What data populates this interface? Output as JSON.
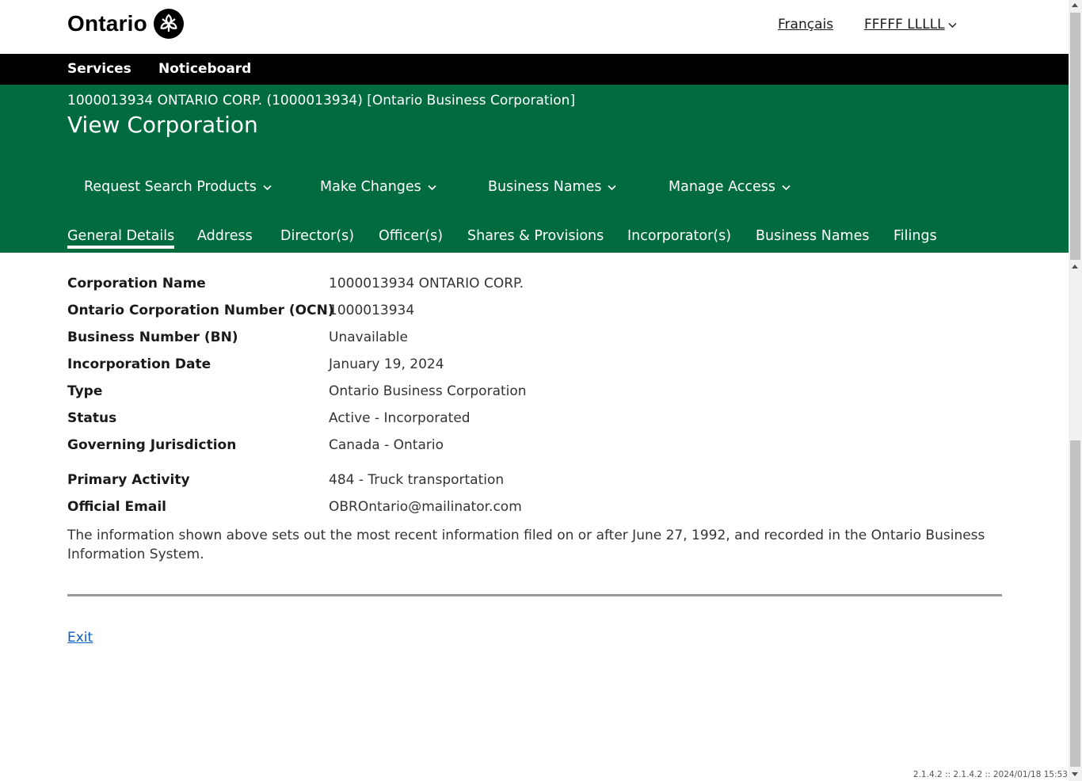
{
  "header": {
    "logo_text": "Ontario",
    "language_link": "Français",
    "user_name": "FFFFF LLLLL"
  },
  "nav": {
    "services": "Services",
    "noticeboard": "Noticeboard"
  },
  "corporation": {
    "heading": "1000013934 ONTARIO CORP. (1000013934) [Ontario Business Corporation]",
    "page_title": "View Corporation"
  },
  "actions": {
    "request_search_products": "Request Search Products",
    "make_changes": "Make Changes",
    "business_names": "Business Names",
    "manage_access": "Manage Access"
  },
  "tabs": {
    "general_details": "General Details",
    "address": "Address",
    "directors": "Director(s)",
    "officers": "Officer(s)",
    "shares": "Shares & Provisions",
    "incorporators": "Incorporator(s)",
    "business_names": "Business Names",
    "filings": "Filings"
  },
  "details": [
    {
      "label": "Corporation Name",
      "value": "1000013934 ONTARIO CORP."
    },
    {
      "label": "Ontario Corporation Number (OCN)",
      "value": "1000013934"
    },
    {
      "label": "Business Number (BN)",
      "value": "Unavailable"
    },
    {
      "label": "Incorporation Date",
      "value": "January 19, 2024"
    },
    {
      "label": "Type",
      "value": "Ontario Business Corporation"
    },
    {
      "label": "Status",
      "value": "Active - Incorporated"
    },
    {
      "label": "Governing Jurisdiction",
      "value": "Canada - Ontario"
    },
    {
      "label": "Primary Activity",
      "value": "484 - Truck transportation"
    },
    {
      "label": "Official Email",
      "value": "OBROntario@mailinator.com"
    }
  ],
  "info_note": "The information shown above sets out the most recent information filed on or after June 27, 1992, and recorded in the Ontario Business Information System.",
  "exit_label": "Exit",
  "version": "2.1.4.2 :: 2.1.4.2 :: 2024/01/18 15:53",
  "colors": {
    "brand_green": "#006b3f",
    "nav_black": "#000000",
    "link_blue": "#0b5fc0"
  },
  "icons": {
    "logo": "ontario-trillium-icon",
    "dropdown": "chevron-down-icon"
  }
}
